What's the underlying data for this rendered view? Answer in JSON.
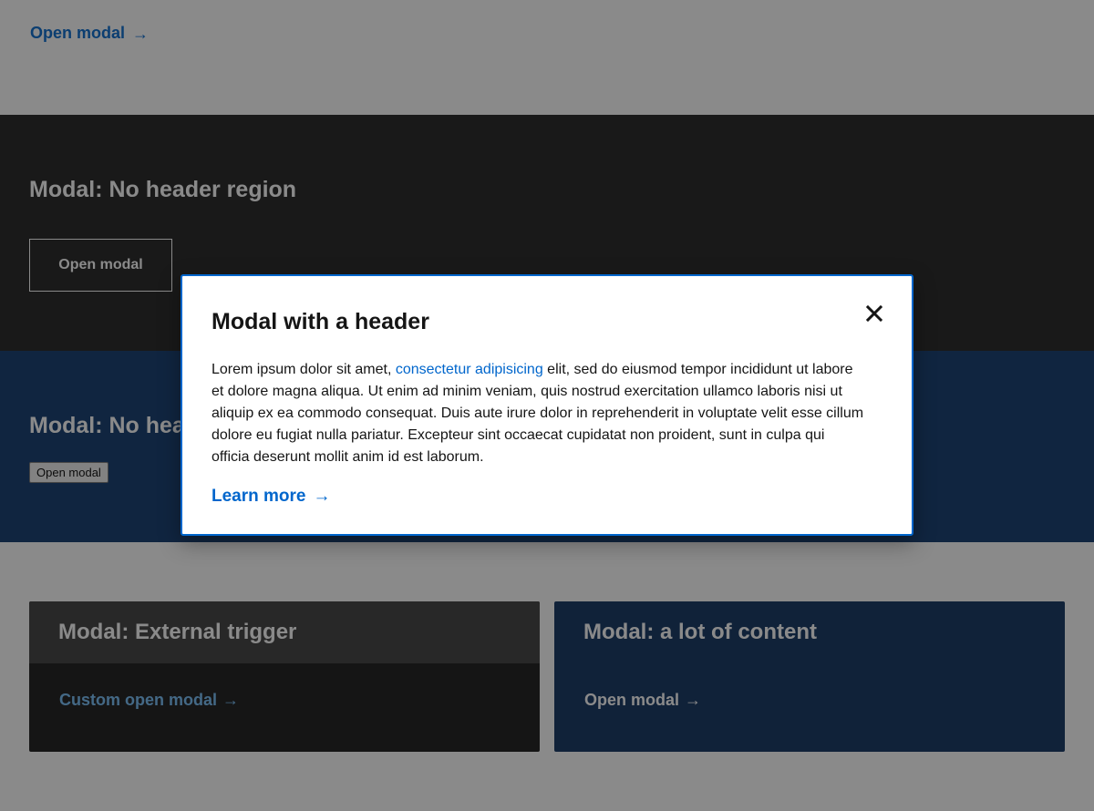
{
  "top_section": {
    "open_modal_link": "Open modal",
    "arrow": "→"
  },
  "dark_section": {
    "heading": "Modal: No header region",
    "button_label": "Open modal"
  },
  "blue_section": {
    "heading": "Modal: No header",
    "button_label": "Open modal"
  },
  "cards": {
    "left": {
      "title": "Modal: External trigger",
      "link": "Custom open modal",
      "arrow": "→"
    },
    "right": {
      "title": "Modal: a lot of content",
      "link": "Open modal",
      "arrow": "→"
    }
  },
  "modal": {
    "title": "Modal with a header",
    "body_before_link": "Lorem ipsum dolor sit amet, ",
    "body_link": "consectetur adipisicing",
    "body_after_link": " elit, sed do eiusmod tempor incididunt ut labore et dolore magna aliqua. Ut enim ad minim veniam, quis nostrud exercitation ullamco laboris nisi ut aliquip ex ea commodo consequat. Duis aute irure dolor in reprehenderit in voluptate velit esse cillum dolore eu fugiat nulla pariatur. Excepteur sint occaecat cupidatat non proident, sunt in culpa qui officia deserunt mollit anim id est laborum.",
    "learn_more": "Learn more",
    "arrow": "→",
    "close_icon": "close-icon"
  },
  "colors": {
    "accent": "#0066cc",
    "overlay": "rgba(21,21,21,0.5)",
    "dark_section": "#1d1d1d",
    "blue_section": "#0a356b"
  }
}
